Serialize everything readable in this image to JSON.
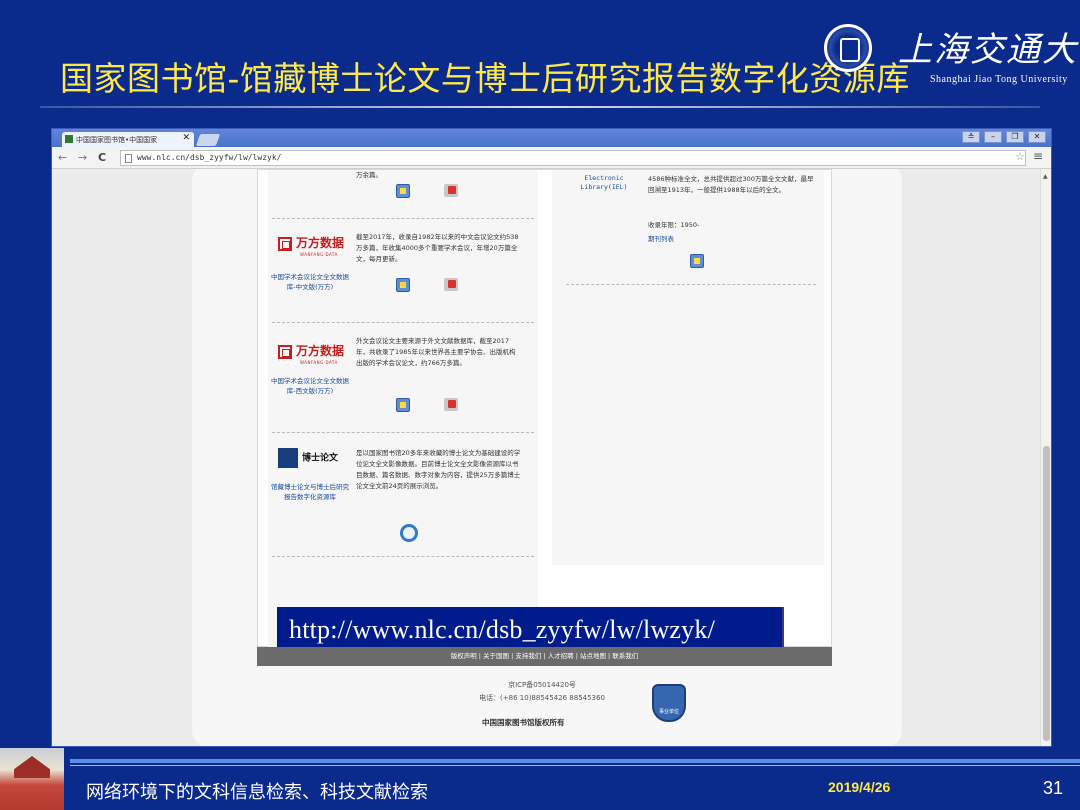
{
  "slide": {
    "title": "国家图书馆-馆藏博士论文与博士后研究报告数字化资源库",
    "logo_cn": "上海交通大学",
    "logo_en": "Shanghai Jiao Tong University",
    "footer_text": "网络环境下的文科信息检索、科技文献检索",
    "date": "2019/4/26",
    "page_number": "31"
  },
  "browser": {
    "tab_title": "中国国家图书馆•中国国家",
    "url": "www.nlc.cn/dsb_zyyfw/lw/lwzyk/"
  },
  "page": {
    "top_text": "万余篇。",
    "wanfang_logo": "万方数据",
    "wanfang_sub": "WANFANG DATA",
    "entry1": {
      "desc": "截至2017年，收录自1982年以来的中文会议论文约538万多篇，年收集4000多个重要学术会议，年增20万篇全文，每月更新。",
      "caption": "中国学术会议论文全文数据库-中文版(万方)"
    },
    "entry2": {
      "desc": "外文会议论文主要来源于外文文献数据库，截至2017年，共收录了1985年以来世界各主要学协会、出版机构出版的学术会议论文，约766万多篇。",
      "caption": "中国学术会议论文全文数据库-西文版(万方)"
    },
    "entry3": {
      "logo": "博士论文",
      "desc": "是以国家图书馆20多年来收藏的博士论文为基础建设的学位论文全文影像数据。目前博士论文全文影像资源库以书目数据、篇名数据、数字对象为内容，提供25万多篇博士论文全文前24页的展示浏览。",
      "caption": "馆藏博士论文与博士后研究报告数字化资源库"
    },
    "iel": {
      "label": "Electronic Library(IEL)",
      "desc": "4586种标准全文，总共提供超过300万篇全文文献，最早回溯至1913年，一般提供1988年以后的全文。",
      "years": "收录年限：1950-",
      "link": "期刊列表"
    },
    "url_banner": "http://www.nlc.cn/dsb_zyyfw/lw/lwzyk/",
    "footer_links": "版权声明 | 关于国图 | 支持我们 | 人才招聘 | 站点地图 | 联系我们",
    "icp": "京ICP备05014420号",
    "phone": "电话：(+86 10)88545426 88545360",
    "copyright": "中国国家图书馆版权所有",
    "badge": "事业单位"
  },
  "colors": {
    "slide_bg": "#0a2a8c",
    "title": "#ffe94a",
    "url_banner_bg": "#001c8c",
    "wanfang_red": "#c41e1e"
  }
}
